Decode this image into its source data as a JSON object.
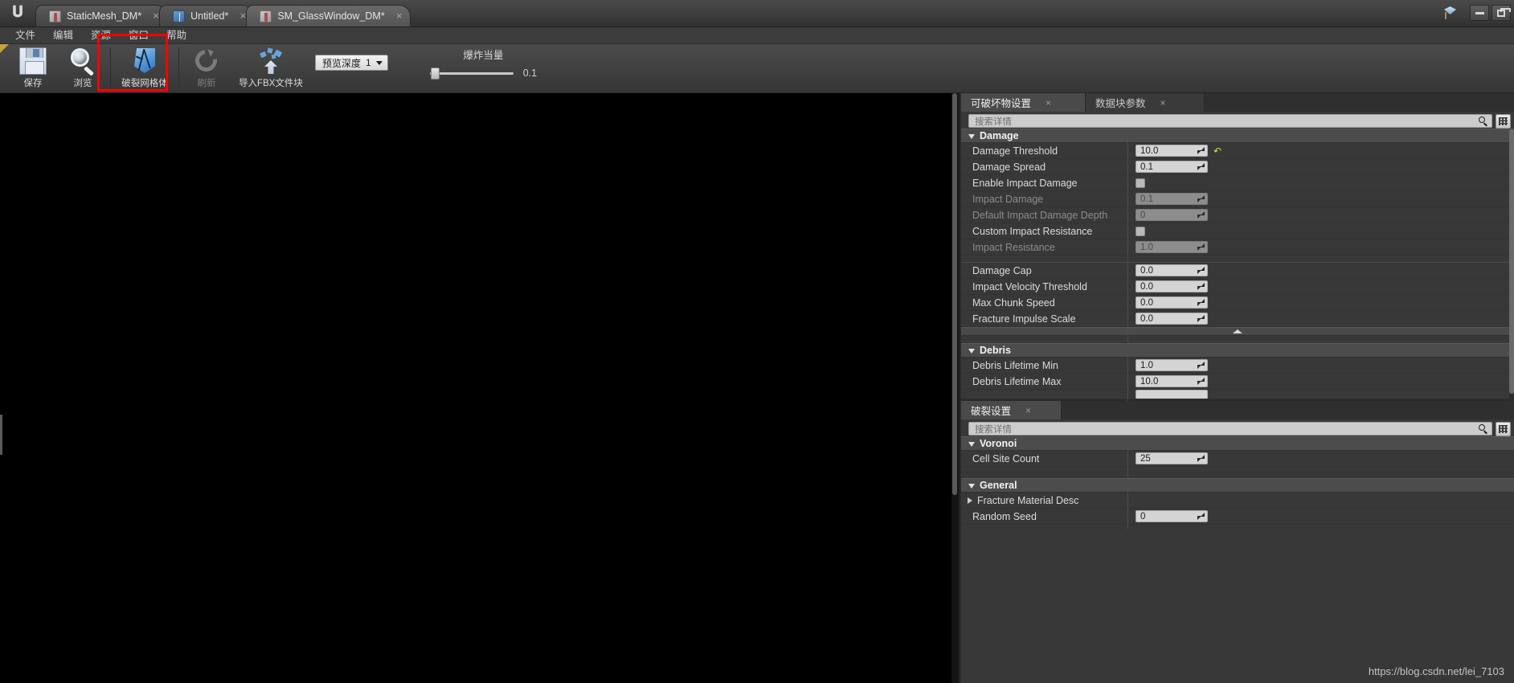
{
  "window": {
    "tabs": [
      {
        "label": "StaticMesh_DM*",
        "icon": "static-mesh-icon",
        "active": false
      },
      {
        "label": "Untitled*",
        "icon": "blueprint-book-icon",
        "active": false
      },
      {
        "label": "SM_GlassWindow_DM*",
        "icon": "static-mesh-icon",
        "active": true
      }
    ],
    "close_glyph": "×",
    "controls": {
      "minimize": "minimize",
      "restore": "restore"
    },
    "gem_icon": "gem-icon"
  },
  "menubar": {
    "items": [
      "文件",
      "编辑",
      "资源",
      "窗口",
      "帮助"
    ]
  },
  "toolbar": {
    "buttons": [
      {
        "label": "保存",
        "icon": "save-icon",
        "disabled": false
      },
      {
        "label": "浏览",
        "icon": "browse-icon",
        "disabled": false
      },
      {
        "label": "破裂网格体",
        "icon": "fracture-mesh-icon",
        "disabled": false,
        "highlighted": true
      },
      {
        "label": "刷新",
        "icon": "refresh-icon",
        "disabled": true
      },
      {
        "label": "导入FBX文件块",
        "icon": "import-fbx-icon",
        "disabled": false
      }
    ],
    "preview_depth": {
      "label": "预览深度",
      "value": "1"
    },
    "explode": {
      "label": "爆炸当量",
      "value": "0.1",
      "slider_percent": 4
    }
  },
  "details_panel": {
    "tabs": [
      {
        "label": "可破坏物设置",
        "active": true,
        "close": "×"
      },
      {
        "label": "数据块参数",
        "active": false,
        "close": "×"
      }
    ],
    "search": {
      "placeholder": "搜索详情",
      "value": "",
      "icon": "search-icon",
      "view_options_icon": "grid-view-icon"
    },
    "sections": [
      {
        "name": "Damage",
        "expanded": true,
        "rows": [
          {
            "label": "Damage Threshold",
            "type": "number",
            "value": "10.0",
            "disabled": false,
            "reset": true
          },
          {
            "label": "Damage Spread",
            "type": "number",
            "value": "0.1",
            "disabled": false,
            "reset": false
          },
          {
            "label": "Enable Impact Damage",
            "type": "checkbox",
            "value": "",
            "disabled": false,
            "checked": false
          },
          {
            "label": "Impact Damage",
            "type": "number",
            "value": "0.1",
            "disabled": true,
            "reset": false
          },
          {
            "label": "Default Impact Damage Depth",
            "type": "number",
            "value": "0",
            "disabled": true,
            "reset": false
          },
          {
            "label": "Custom Impact Resistance",
            "type": "checkbox",
            "value": "",
            "disabled": false,
            "checked": false
          },
          {
            "label": "Impact Resistance",
            "type": "number",
            "value": "1.0",
            "disabled": true,
            "reset": false
          },
          {
            "label": "__GAP__",
            "type": "gap",
            "value": "",
            "disabled": false
          },
          {
            "label": "Damage Cap",
            "type": "number",
            "value": "0.0",
            "disabled": false,
            "reset": false
          },
          {
            "label": "Impact Velocity Threshold",
            "type": "number",
            "value": "0.0",
            "disabled": false,
            "reset": false
          },
          {
            "label": "Max Chunk Speed",
            "type": "number",
            "value": "0.0",
            "disabled": false,
            "reset": false
          },
          {
            "label": "Fracture Impulse Scale",
            "type": "number",
            "value": "0.0",
            "disabled": false,
            "reset": false
          }
        ]
      },
      {
        "name": "Debris",
        "expanded": true,
        "rows": [
          {
            "label": "Debris Lifetime Min",
            "type": "number",
            "value": "1.0",
            "disabled": false,
            "reset": false
          },
          {
            "label": "Debris Lifetime Max",
            "type": "number",
            "value": "10.0",
            "disabled": false,
            "reset": false
          }
        ]
      }
    ]
  },
  "fracture_panel": {
    "tabs": [
      {
        "label": "破裂设置",
        "active": true,
        "close": "×"
      }
    ],
    "search": {
      "placeholder": "搜索详情",
      "value": "",
      "icon": "search-icon",
      "view_options_icon": "grid-view-icon"
    },
    "sections": [
      {
        "name": "Voronoi",
        "expanded": true,
        "rows": [
          {
            "label": "Cell Site Count",
            "type": "number",
            "value": "25",
            "disabled": false,
            "reset": false
          }
        ]
      },
      {
        "name": "General",
        "expanded": true,
        "rows": [
          {
            "label": "Fracture Material Desc",
            "type": "expander",
            "value": "",
            "disabled": false
          },
          {
            "label": "Random Seed",
            "type": "number",
            "value": "0",
            "disabled": false,
            "reset": false
          }
        ]
      }
    ]
  },
  "watermark": {
    "text": "https://blog.csdn.net/lei_7103"
  },
  "colors": {
    "accent_red": "#fa0000",
    "reset_yellow": "#e3d94a",
    "panel_bg": "#383838",
    "category_bg": "#4c4c4c",
    "field_bg": "#d4d4d4",
    "viewport_bg": "#000000"
  }
}
